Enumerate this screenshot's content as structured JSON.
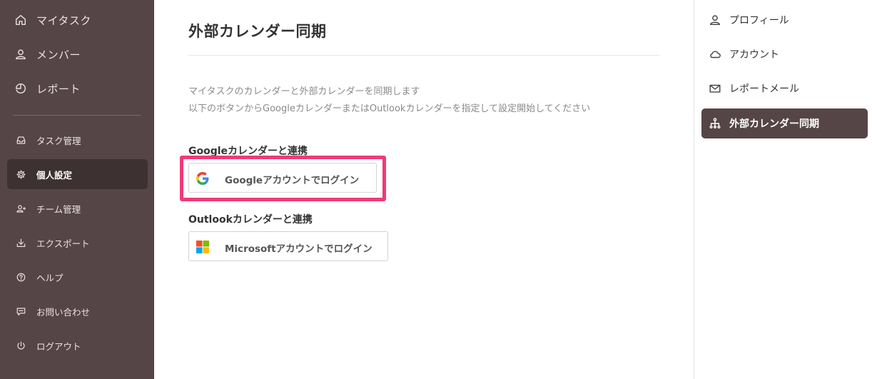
{
  "sidebar": {
    "main_items": [
      {
        "label": "マイタスク",
        "icon": "home-icon"
      },
      {
        "label": "メンバー",
        "icon": "person-icon"
      },
      {
        "label": "レポート",
        "icon": "report-icon"
      }
    ],
    "sub_items": [
      {
        "label": "タスク管理",
        "icon": "inbox-icon"
      },
      {
        "label": "個人設定",
        "icon": "gear-icon",
        "active": true
      },
      {
        "label": "チーム管理",
        "icon": "team-icon"
      },
      {
        "label": "エクスポート",
        "icon": "download-icon"
      },
      {
        "label": "ヘルプ",
        "icon": "help-icon"
      },
      {
        "label": "お問い合わせ",
        "icon": "chat-icon"
      },
      {
        "label": "ログアウト",
        "icon": "power-icon"
      }
    ]
  },
  "main": {
    "title": "外部カレンダー同期",
    "description_line1": "マイタスクのカレンダーと外部カレンダーを同期します",
    "description_line2": "以下のボタンからGoogleカレンダーまたはOutlookカレンダーを指定して設定開始してください",
    "google_section_label": "Googleカレンダーと連携",
    "google_button_label": "Googleアカウントでログイン",
    "outlook_section_label": "Outlookカレンダーと連携",
    "microsoft_button_label": "Microsoftアカウントでログイン"
  },
  "settings_menu": {
    "items": [
      {
        "label": "プロフィール",
        "icon": "user-icon"
      },
      {
        "label": "アカウント",
        "icon": "cloud-icon"
      },
      {
        "label": "レポートメール",
        "icon": "mail-icon"
      },
      {
        "label": "外部カレンダー同期",
        "icon": "sitemap-icon",
        "active": true
      }
    ]
  },
  "colors": {
    "sidebar_bg": "#564546",
    "sidebar_active_bg": "#3d3132",
    "highlight": "#f03a79",
    "settings_active_bg": "#564546"
  }
}
